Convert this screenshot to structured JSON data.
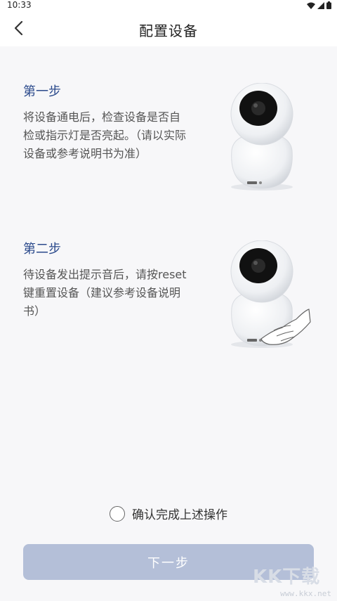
{
  "status_bar": {
    "time": "10:33",
    "icons": [
      "wifi-icon",
      "cellular-signal-icon",
      "battery-icon"
    ]
  },
  "header": {
    "back_icon": "chevron-left-icon",
    "title": "配置设备"
  },
  "steps": [
    {
      "title": "第一步",
      "description": "将设备通电后，检查设备是否自检或指示灯是否亮起。（请以实际设备或参考说明书为准）",
      "image_icon": "camera-illustration-icon"
    },
    {
      "title": "第二步",
      "description": "待设备发出提示音后，请按reset键重置设备（建议参考设备说明书）",
      "image_icon": "camera-reset-hand-illustration-icon"
    }
  ],
  "confirm": {
    "label": "确认完成上述操作",
    "checked": false
  },
  "next_button": {
    "label": "下一步"
  },
  "watermark": {
    "logo": "KK下载",
    "url": "www.kkx.net"
  },
  "colors": {
    "step_title": "#2b4a8c",
    "button_disabled": "#b4bfd8",
    "background": "#f7f7f9"
  }
}
